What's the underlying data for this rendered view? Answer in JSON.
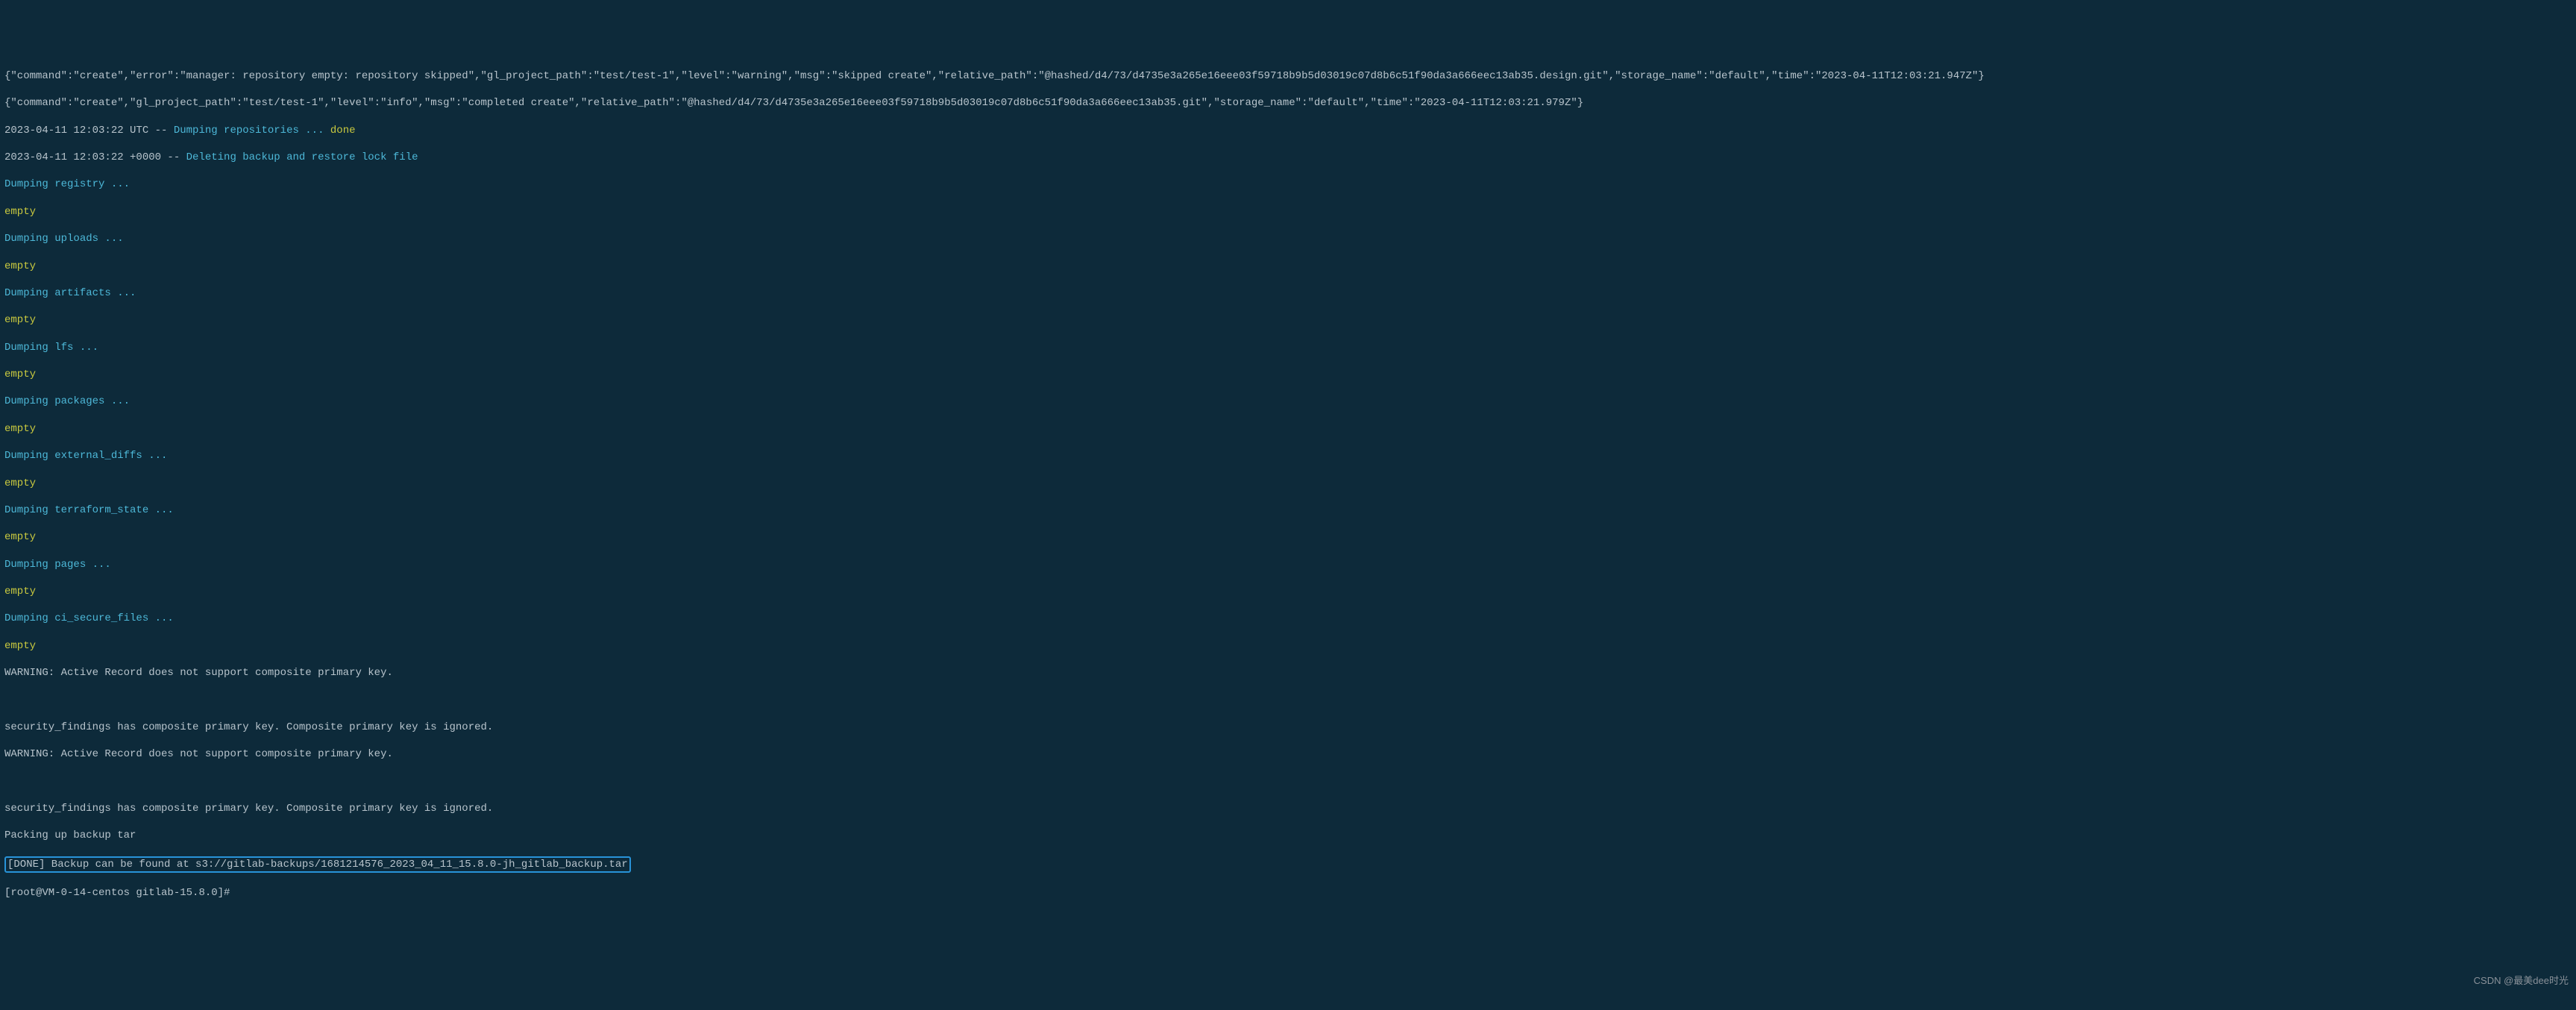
{
  "terminal": {
    "json_line_1": "{\"command\":\"create\",\"error\":\"manager: repository empty: repository skipped\",\"gl_project_path\":\"test/test-1\",\"level\":\"warning\",\"msg\":\"skipped create\",\"relative_path\":\"@hashed/d4/73/d4735e3a265e16eee03f59718b9b5d03019c07d8b6c51f90da3a666eec13ab35.design.git\",\"storage_name\":\"default\",\"time\":\"2023-04-11T12:03:21.947Z\"}",
    "json_line_2": "{\"command\":\"create\",\"gl_project_path\":\"test/test-1\",\"level\":\"info\",\"msg\":\"completed create\",\"relative_path\":\"@hashed/d4/73/d4735e3a265e16eee03f59718b9b5d03019c07d8b6c51f90da3a666eec13ab35.git\",\"storage_name\":\"default\",\"time\":\"2023-04-11T12:03:21.979Z\"}",
    "ts_utc": "2023-04-11 12:03:22 UTC -- ",
    "dumping_repos": "Dumping repositories ... ",
    "done": "done",
    "ts_tz": "2023-04-11 12:03:22 +0000 -- ",
    "deleting_lock": "Deleting backup and restore lock file",
    "dump_registry": "Dumping registry ...",
    "empty": "empty",
    "dump_uploads": "Dumping uploads ...",
    "dump_artifacts": "Dumping artifacts ...",
    "dump_lfs": "Dumping lfs ...",
    "dump_packages": "Dumping packages ...",
    "dump_external_diffs": "Dumping external_diffs ...",
    "dump_terraform": "Dumping terraform_state ...",
    "dump_pages": "Dumping pages ...",
    "dump_ci_secure": "Dumping ci_secure_files ...",
    "warn_1": "WARNING: Active Record does not support composite primary key.",
    "blank": " ",
    "sec_findings": "security_findings has composite primary key. Composite primary key is ignored.",
    "warn_2": "WARNING: Active Record does not support composite primary key.",
    "sec_findings_2": "security_findings has composite primary key. Composite primary key is ignored.",
    "packing": "Packing up backup tar",
    "done_backup": "[DONE] Backup can be found at s3://gitlab-backups/1681214576_2023_04_11_15.8.0-jh_gitlab_backup.tar",
    "prompt": "[root@VM-0-14-centos gitlab-15.8.0]#"
  },
  "watermark": "CSDN @最美dee时光"
}
